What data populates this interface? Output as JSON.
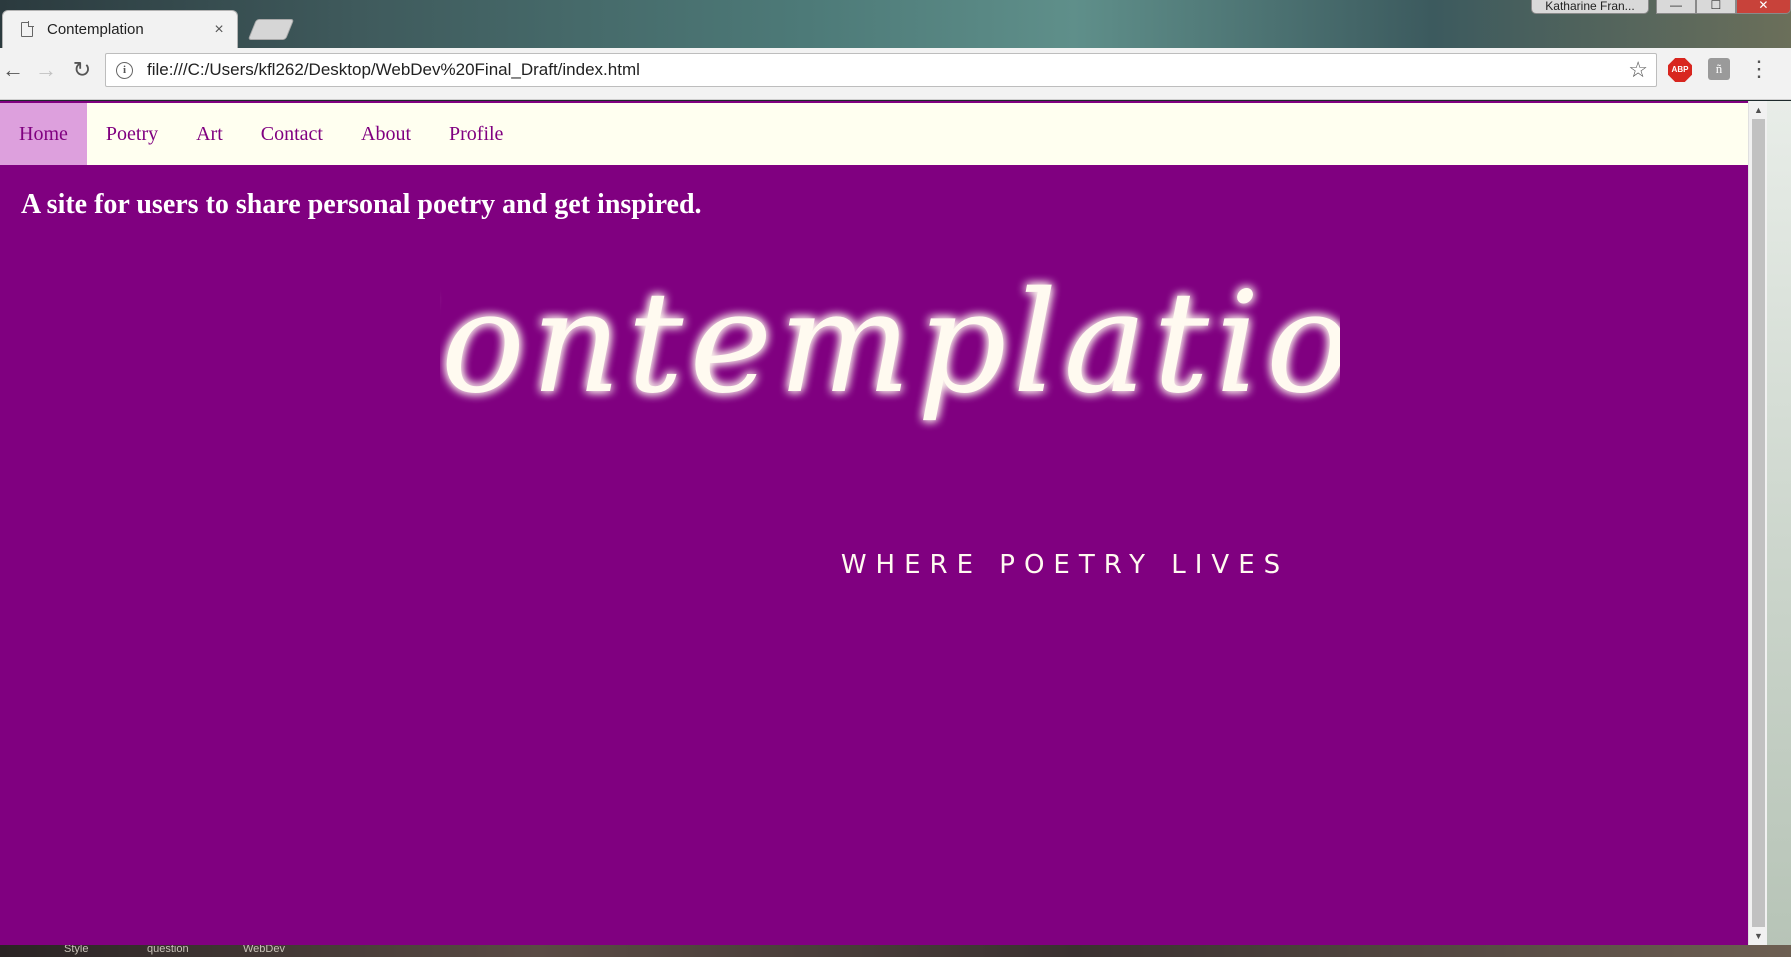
{
  "window": {
    "user_profile": "Katharine Fran...",
    "controls": {
      "minimize": "—",
      "maximize": "☐",
      "close": "✕"
    }
  },
  "tab": {
    "title": "Contemplation",
    "close_glyph": "×"
  },
  "toolbar": {
    "back_glyph": "←",
    "forward_glyph": "→",
    "reload_glyph": "↻",
    "info_glyph": "i",
    "url": "file:///C:/Users/kfl262/Desktop/WebDev%20Final_Draft/index.html",
    "star_glyph": "☆",
    "abp_label": "ABP",
    "extension_glyph": "ñ",
    "menu_glyph": "⋮"
  },
  "site": {
    "nav": [
      {
        "label": "Home",
        "active": true
      },
      {
        "label": "Poetry",
        "active": false
      },
      {
        "label": "Art",
        "active": false
      },
      {
        "label": "Contact",
        "active": false
      },
      {
        "label": "About",
        "active": false
      },
      {
        "label": "Profile",
        "active": false
      }
    ],
    "tagline": "A site for users to share personal poetry and get inspired.",
    "logo": {
      "title": "Contemplation",
      "subtitle": "WHERE POETRY LIVES"
    },
    "colors": {
      "background": "#800080",
      "nav_background": "#fffff0",
      "nav_active": "#dda0dd",
      "nav_text": "#800080",
      "logo_text": "#fffaf0"
    }
  },
  "taskbar": {
    "items": [
      "Style",
      "question",
      "WebDev"
    ]
  },
  "scrollbar": {
    "up_glyph": "▲",
    "down_glyph": "▼"
  }
}
